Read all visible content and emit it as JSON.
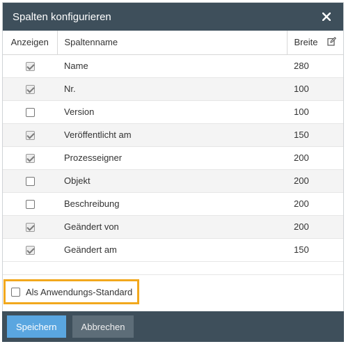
{
  "dialog": {
    "title": "Spalten konfigurieren",
    "close_icon": "close-icon"
  },
  "table": {
    "headers": {
      "show": "Anzeigen",
      "name": "Spaltenname",
      "width": "Breite",
      "edit_icon": "edit-icon"
    },
    "rows": [
      {
        "checked": true,
        "name": "Name",
        "width": "280"
      },
      {
        "checked": true,
        "name": "Nr.",
        "width": "100"
      },
      {
        "checked": false,
        "name": "Version",
        "width": "100"
      },
      {
        "checked": true,
        "name": "Veröffentlicht am",
        "width": "150"
      },
      {
        "checked": true,
        "name": "Prozesseigner",
        "width": "200"
      },
      {
        "checked": false,
        "name": "Objekt",
        "width": "200"
      },
      {
        "checked": false,
        "name": "Beschreibung",
        "width": "200"
      },
      {
        "checked": true,
        "name": "Geändert von",
        "width": "200"
      },
      {
        "checked": true,
        "name": "Geändert am",
        "width": "150"
      }
    ]
  },
  "option": {
    "label": "Als Anwendungs-Standard",
    "checked": false
  },
  "buttons": {
    "save": "Speichern",
    "cancel": "Abbrechen"
  },
  "colors": {
    "header_bg": "#3e4f5b",
    "primary": "#5aa6e0",
    "highlight": "#f2a81d"
  }
}
